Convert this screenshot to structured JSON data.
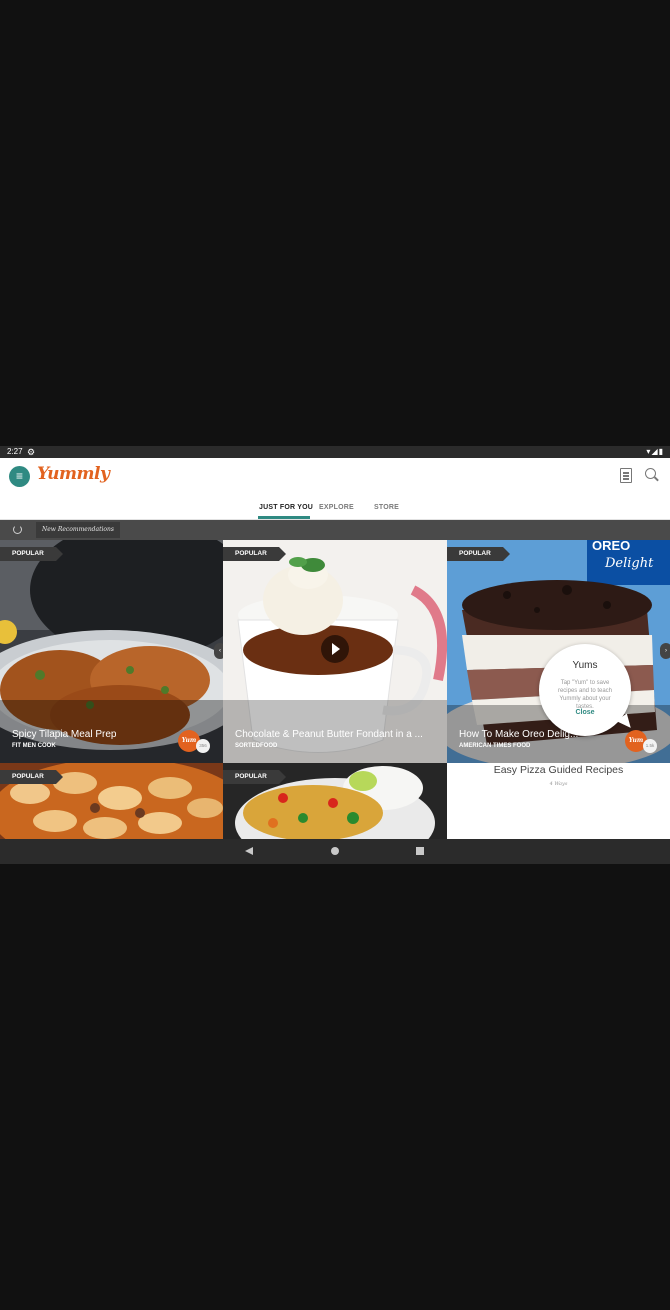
{
  "status_bar": {
    "time": "2:27",
    "gear": "⚙",
    "system_icons": "▾◢▮"
  },
  "app": {
    "logo": "Yummly",
    "menu_glyph": "≡"
  },
  "tabs": [
    {
      "label": "JUST FOR YOU"
    },
    {
      "label": "EXPLORE"
    },
    {
      "label": "STORE"
    }
  ],
  "recommendations": {
    "label": "New Recommendations"
  },
  "cards": [
    {
      "badge": "POPULAR",
      "title": "Spicy Tilapia Meal Prep",
      "source": "FIT MEN COOK",
      "yum": "Yum",
      "yum_count": "356"
    },
    {
      "badge": "POPULAR",
      "title": "Chocolate & Peanut Butter Fondant in a ...",
      "source": "SORTEDFOOD"
    },
    {
      "badge": "POPULAR",
      "title": "How To Make Oreo Delig...",
      "source": "AMERICAN TIMES FOOD",
      "yum": "Yum",
      "yum_count": "1.5k",
      "image_text_brand": "OREO",
      "image_text_script": "Delight"
    },
    {
      "badge": "POPULAR"
    },
    {
      "badge": "POPULAR"
    }
  ],
  "tooltip": {
    "title": "Yums",
    "body": "Tap \"Yum\" to save recipes and to teach Yummly about your tastes.",
    "close": "Close"
  },
  "guided": {
    "title": "Easy Pizza Guided Recipes",
    "subtitle": "4 Ways"
  },
  "icons": {
    "arrow_left": "‹",
    "arrow_right": "›"
  },
  "colors": {
    "accent": "#2f8a82",
    "brand": "#e2621f"
  }
}
